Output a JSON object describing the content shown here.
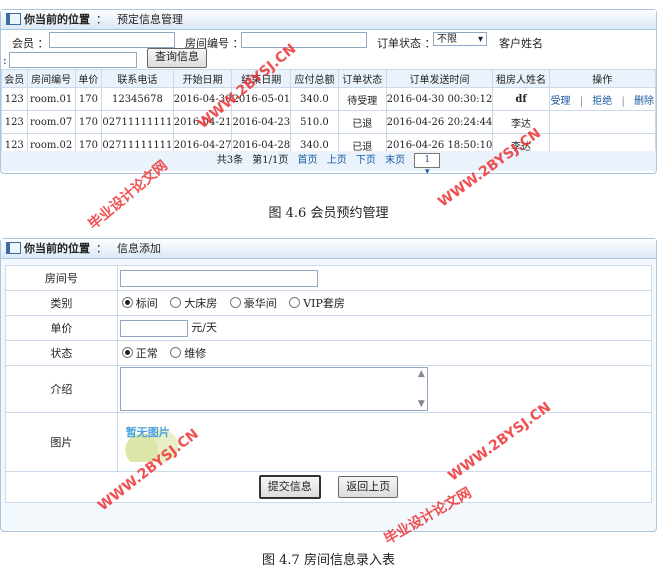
{
  "panel1": {
    "location_label": "你当前的位置",
    "colon": "：",
    "location_value": "预定信息管理",
    "filters": {
      "member_label": "会员 ：",
      "room_label": "房间编号 ：",
      "status_label": "订单状态 ：",
      "status_value": "不限",
      "customer_label": "客户姓名",
      "colon_prefix": ":",
      "query_button": "查询信息"
    },
    "columns": [
      "会员",
      "房间编号",
      "单价",
      "联系电话",
      "开始日期",
      "结束日期",
      "应付总额",
      "订单状态",
      "订单发送时间",
      "租房人姓名",
      "操作"
    ],
    "rows": [
      {
        "member": "123",
        "room": "room.01",
        "price": "170",
        "phone": "12345678",
        "start": "2016-04-30",
        "end": "2016-05-01",
        "total": "340.0",
        "status": "待受理",
        "sent": "2016-04-30 00:30:12",
        "renter": "df",
        "op1": "受理",
        "op2": "拒绝",
        "op3": "删除"
      },
      {
        "member": "123",
        "room": "room.07",
        "price": "170",
        "phone": "02711111111",
        "start": "2016-04-21",
        "end": "2016-04-23",
        "total": "510.0",
        "status": "已退",
        "sent": "2016-04-26 20:24:44",
        "renter": "李达"
      },
      {
        "member": "123",
        "room": "room.02",
        "price": "170",
        "phone": "02711111111",
        "start": "2016-04-27",
        "end": "2016-04-28",
        "total": "340.0",
        "status": "已退",
        "sent": "2016-04-26 18:50:10",
        "renter": "李达"
      }
    ],
    "op_sep": "|",
    "pager": {
      "total": "共3条",
      "page": "第1/1页",
      "first": "首页",
      "prev": "上页",
      "next": "下页",
      "last": "末页",
      "page_select": "1"
    }
  },
  "caption1": "图 4.6  会员预约管理",
  "panel2": {
    "location_label": "你当前的位置",
    "colon": "：",
    "location_value": "信息添加",
    "fields": {
      "room_label": "房间号",
      "type_label": "类别",
      "type_options": [
        "标间",
        "大床房",
        "豪华间",
        "VIP套房"
      ],
      "price_label": "单价",
      "price_unit": "元/天",
      "state_label": "状态",
      "state_options": [
        "正常",
        "维修"
      ],
      "intro_label": "介绍",
      "image_label": "图片",
      "image_placeholder": "暂无图片"
    },
    "submit_button": "提交信息",
    "back_button": "返回上页"
  },
  "caption2": "图 4.7  房间信息录入表",
  "watermarks": [
    "WWW.2BYSJ.CN",
    "毕业设计论文网"
  ]
}
